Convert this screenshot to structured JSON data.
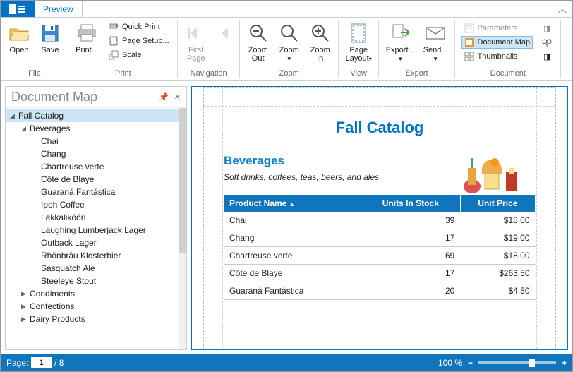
{
  "tab": "Preview",
  "ribbon": {
    "file": {
      "label": "File",
      "open": "Open",
      "save": "Save"
    },
    "print": {
      "label": "Print",
      "print": "Print...",
      "quick": "Quick Print",
      "setup": "Page Setup...",
      "scale": "Scale"
    },
    "nav": {
      "label": "Navigation",
      "first": "First\nPage"
    },
    "zoom": {
      "label": "Zoom",
      "out": "Zoom\nOut",
      "z": "Zoom",
      "in": "Zoom\nIn"
    },
    "view": {
      "label": "View",
      "layout": "Page\nLayout"
    },
    "export": {
      "label": "Export",
      "export": "Export...",
      "send": "Send..."
    },
    "doc": {
      "label": "Document",
      "params": "Parameters",
      "map": "Document Map",
      "thumbs": "Thumbnails"
    }
  },
  "docmap": {
    "title": "Document Map",
    "root": "Fall Catalog",
    "cats": [
      {
        "name": "Beverages",
        "expanded": true,
        "items": [
          "Chai",
          "Chang",
          "Chartreuse verte",
          "Côte de Blaye",
          "Guaraná Fantástica",
          "Ipoh Coffee",
          "Lakkalikööri",
          "Laughing Lumberjack Lager",
          "Outback Lager",
          "Rhönbräu Klosterbier",
          "Sasquatch Ale",
          "Steeleye Stout"
        ]
      },
      {
        "name": "Condiments",
        "expanded": false
      },
      {
        "name": "Confections",
        "expanded": false
      },
      {
        "name": "Dairy Products",
        "expanded": false
      }
    ]
  },
  "report": {
    "title": "Fall Catalog",
    "section": "Beverages",
    "desc": "Soft drinks, coffees, teas, beers, and ales",
    "cols": [
      "Product Name",
      "Units In Stock",
      "Unit Price"
    ],
    "rows": [
      [
        "Chai",
        "39",
        "$18.00"
      ],
      [
        "Chang",
        "17",
        "$19.00"
      ],
      [
        "Chartreuse verte",
        "69",
        "$18.00"
      ],
      [
        "Côte de Blaye",
        "17",
        "$263.50"
      ],
      [
        "Guaraná Fantástica",
        "20",
        "$4.50"
      ]
    ]
  },
  "status": {
    "page_lbl": "Page:",
    "page": "1",
    "total": "/ 8",
    "zoom": "100 %"
  }
}
